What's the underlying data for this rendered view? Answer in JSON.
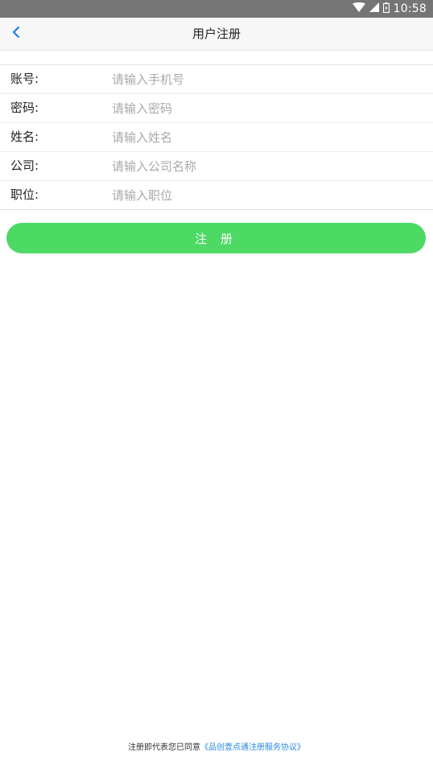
{
  "status_bar": {
    "time": "10:58",
    "icons": [
      "wifi-icon",
      "signal-icon",
      "battery-icon"
    ],
    "background": "#757575"
  },
  "header": {
    "title": "用户注册",
    "back_icon": "chevron-left-icon",
    "accent": "#1a7fe8"
  },
  "form": {
    "fields": [
      {
        "label": "账号:",
        "placeholder": "请输入手机号",
        "value": ""
      },
      {
        "label": "密码:",
        "placeholder": "请输入密码",
        "value": ""
      },
      {
        "label": "姓名:",
        "placeholder": "请输入姓名",
        "value": ""
      },
      {
        "label": "公司:",
        "placeholder": "请输入公司名称",
        "value": ""
      },
      {
        "label": "职位:",
        "placeholder": "请输入职位",
        "value": ""
      }
    ]
  },
  "submit": {
    "label": "注 册",
    "color": "#4cd964"
  },
  "footer": {
    "agreement_text": "注册即代表您已同意",
    "agreement_link": "《品创壹点通注册服务协议》",
    "link_color": "#2a87e8"
  }
}
